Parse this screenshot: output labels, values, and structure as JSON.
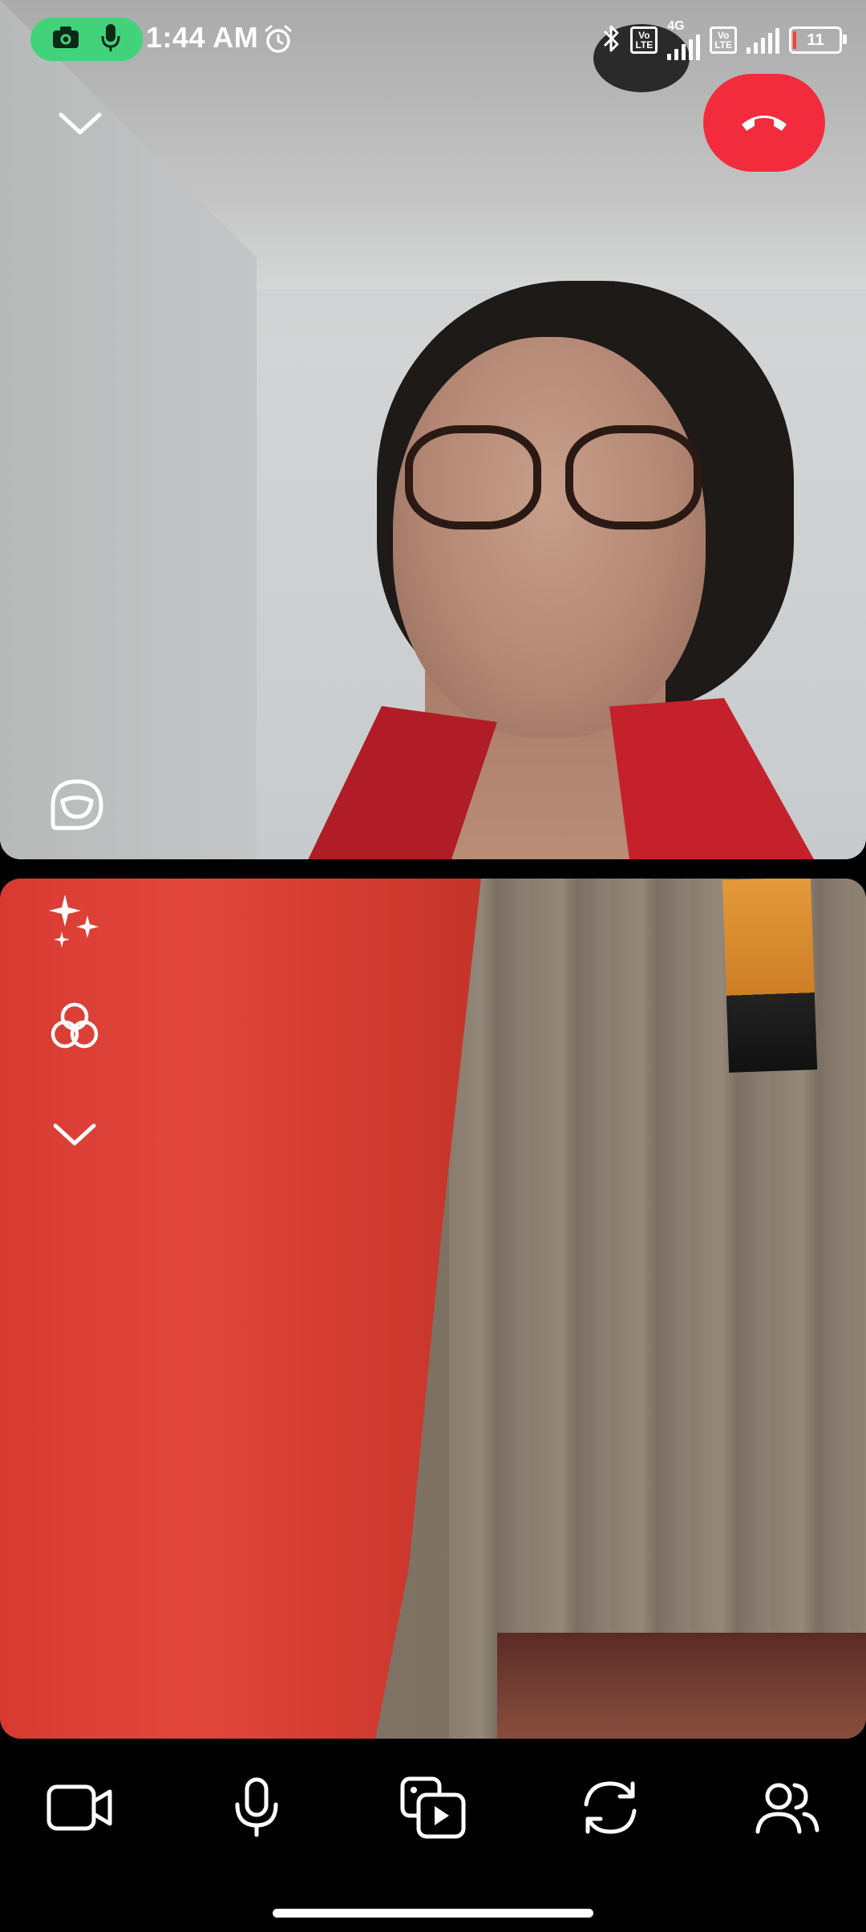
{
  "status_bar": {
    "time": "1:44 AM",
    "network_label": "4G",
    "volte_label_top": "Vo",
    "volte_label_bottom": "LTE",
    "battery_level": "11",
    "privacy_indicators": [
      "camera-icon",
      "microphone-icon"
    ]
  },
  "call": {
    "remote_view": "remote-participant-video",
    "self_view": "self-camera-video"
  },
  "toolbar": {
    "items": [
      {
        "icon": "video-camera-icon"
      },
      {
        "icon": "microphone-icon"
      },
      {
        "icon": "media-share-icon"
      },
      {
        "icon": "flip-camera-icon"
      },
      {
        "icon": "participants-icon"
      }
    ]
  },
  "colors": {
    "end_call": "#f22c3d",
    "privacy_pill": "#42d37a",
    "background": "#000000"
  }
}
